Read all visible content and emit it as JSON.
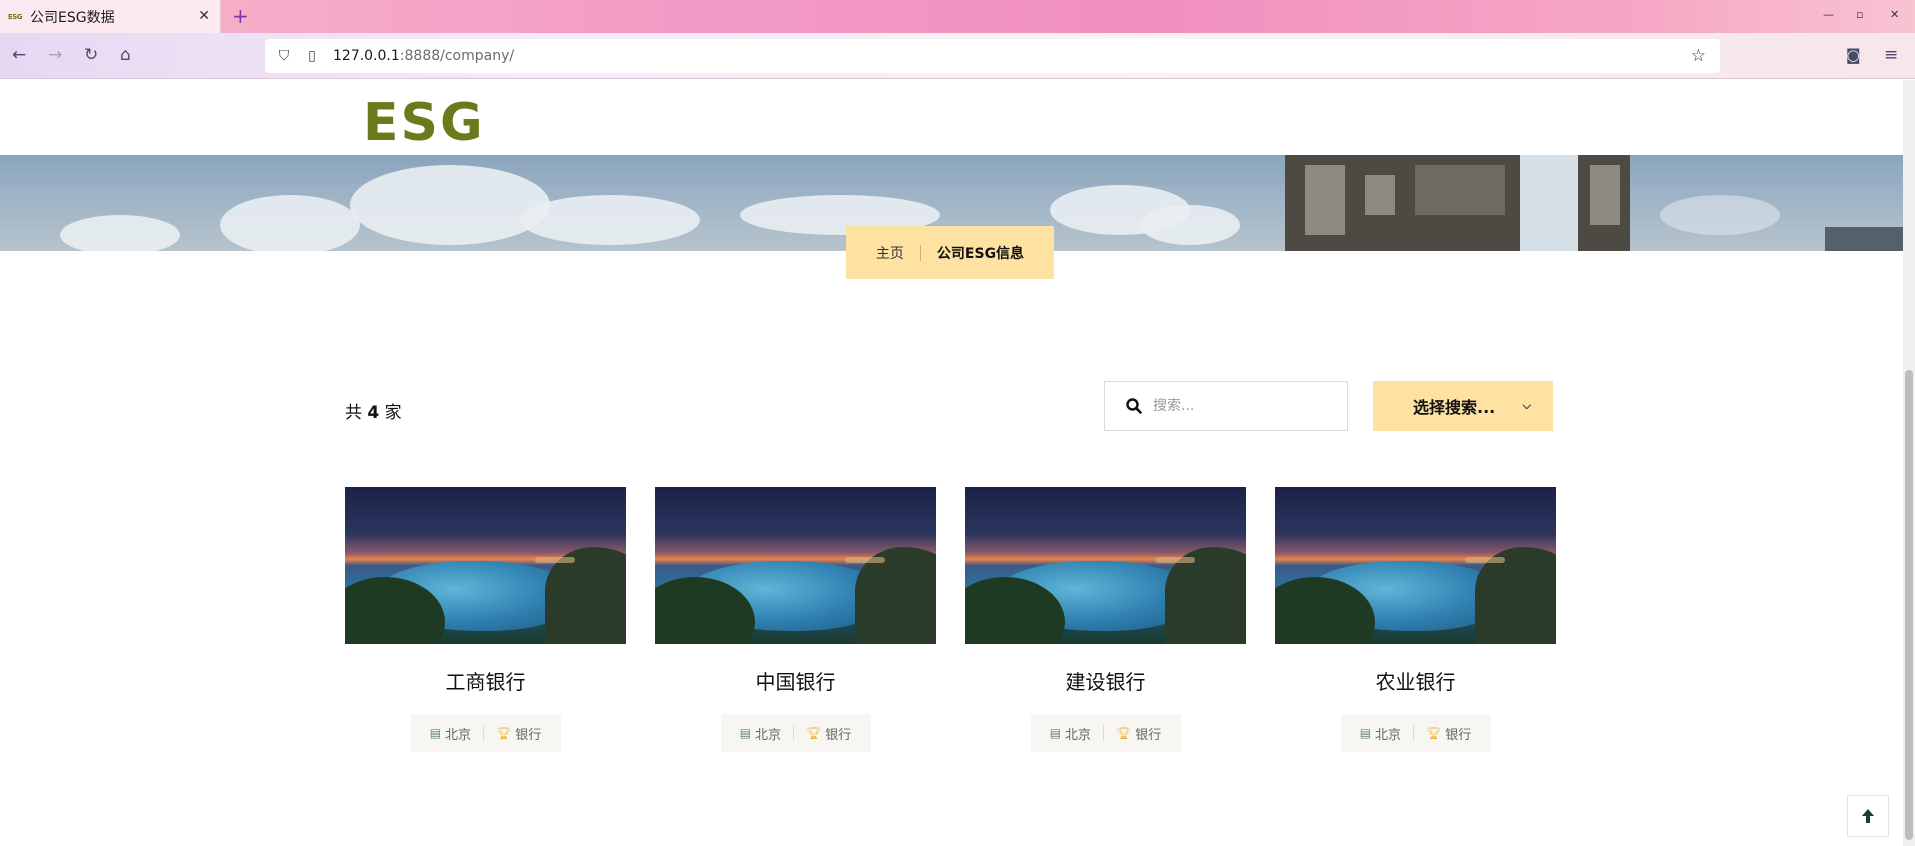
{
  "browser": {
    "tab_title": "公司ESG数据",
    "tab_favicon_text": "ESG",
    "url_host": "127.0.0.1",
    "url_path": ":8888/company/"
  },
  "site": {
    "logo_text": "ESG"
  },
  "breadcrumb": {
    "home": "主页",
    "current": "公司ESG信息"
  },
  "toolbar": {
    "count_prefix": "共 ",
    "count_value": "4",
    "count_suffix": " 家",
    "search_placeholder": "搜索...",
    "select_label": "选择搜索..."
  },
  "companies": [
    {
      "name": "工商银行",
      "location": "北京",
      "industry": "银行"
    },
    {
      "name": "中国银行",
      "location": "北京",
      "industry": "银行"
    },
    {
      "name": "建设银行",
      "location": "北京",
      "industry": "银行"
    },
    {
      "name": "农业银行",
      "location": "北京",
      "industry": "银行"
    }
  ],
  "colors": {
    "brand_olive": "#6b7a1b",
    "accent_yellow": "#fde2a2"
  }
}
